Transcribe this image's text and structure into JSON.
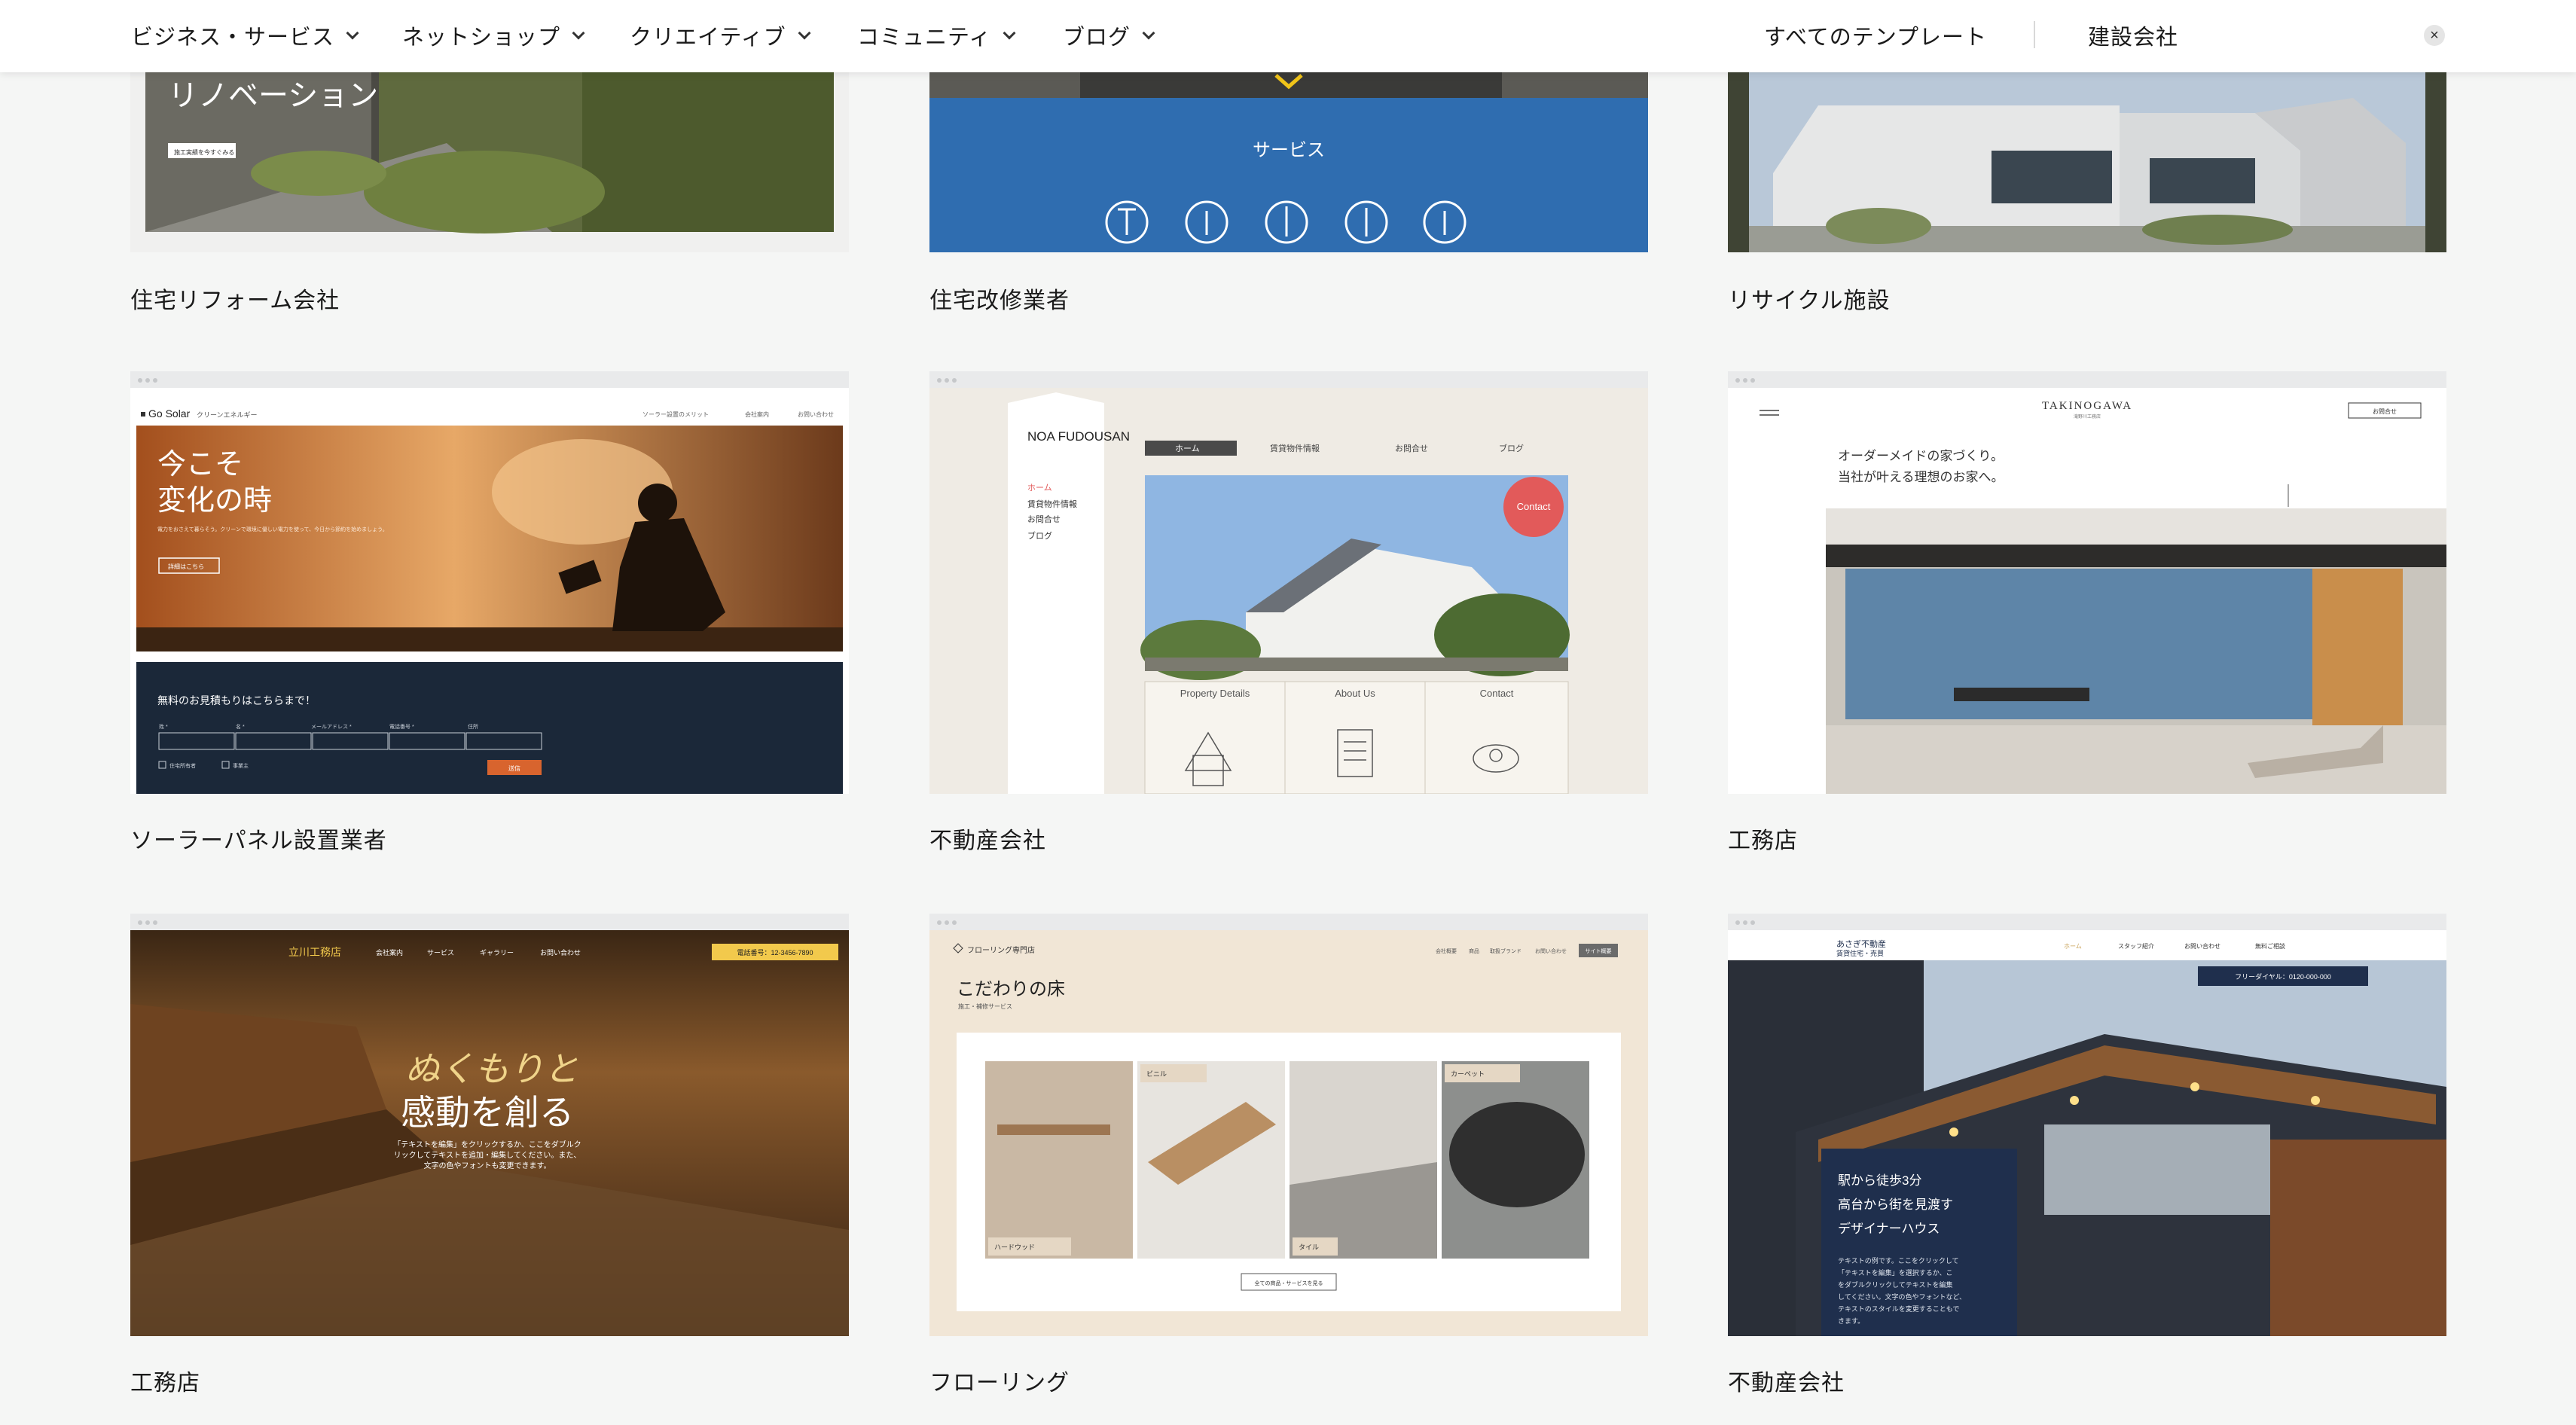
{
  "nav": {
    "items": [
      {
        "label": "ビジネス・サービス"
      },
      {
        "label": "ネットショップ"
      },
      {
        "label": "クリエイティブ"
      },
      {
        "label": "コミュニティ"
      },
      {
        "label": "ブログ"
      }
    ],
    "all_templates": "すべてのテンプレート",
    "search_value": "建設会社",
    "clear_symbol": "×"
  },
  "cards": [
    {
      "caption": "住宅リフォーム会社",
      "preview": {
        "heading": "リノベーション",
        "button": "施工実績を今すぐみる"
      }
    },
    {
      "caption": "住宅改修業者",
      "preview": {
        "heading": "サービス"
      }
    },
    {
      "caption": "リサイクル施設",
      "preview": {}
    },
    {
      "caption": "ソーラーパネル設置業者",
      "preview": {
        "brand": "Go Solar",
        "brand_sub": "クリーンエネルギー",
        "menu": [
          "ソーラー設置のメリット",
          "会社案内",
          "お問い合わせ"
        ],
        "headline1": "今こそ",
        "headline2": "変化の時",
        "body": "電力をおさえて暮らそう。クリーンで環境に優しい電力を使って、今日から節約を始めましょう。",
        "cta": "詳細はこちら",
        "form_title": "無料のお見積もりはこちらまで！",
        "fields": [
          "姓 *",
          "名 *",
          "メールアドレス *",
          "電話番号 *",
          "住所"
        ],
        "checks": [
          "住宅所有者",
          "事業主"
        ],
        "submit": "送信"
      }
    },
    {
      "caption": "不動産会社",
      "preview": {
        "logo": "NOA FUDOUSAN",
        "side_menu": [
          "ホーム",
          "賃貸物件情報",
          "お問合せ",
          "ブログ"
        ],
        "top_menu": [
          "ホーム",
          "賃貸物件情報",
          "お問合せ",
          "ブログ"
        ],
        "badge": "Contact",
        "panels": [
          "Property Details",
          "About Us",
          "Contact"
        ]
      }
    },
    {
      "caption": "工務店",
      "preview": {
        "brand": "TAKINOGAWA",
        "brand_sub": "滝野川工務店",
        "button": "お問合せ",
        "line1": "オーダーメイドの家づくり。",
        "line2": "当社が叶える理想のお家へ。"
      }
    },
    {
      "caption": "工務店",
      "preview": {
        "brand": "立川工務店",
        "menu": [
          "会社案内",
          "サービス",
          "ギャラリー",
          "お問い合わせ"
        ],
        "phone": "電話番号：12-3456-7890",
        "line1": "ぬくもりと",
        "line2": "感動を創る",
        "body1": "「テキストを編集」をクリックするか、ここをダブルク",
        "body2": "リックしてテキストを追加・編集してください。また、",
        "body3": "文字の色やフォントも変更できます。"
      }
    },
    {
      "caption": "フローリング",
      "preview": {
        "brand": "フローリング専門店",
        "menu": [
          "会社概要",
          "商品",
          "取扱ブランド",
          "お問い合わせ"
        ],
        "menu_active": "サイト概要",
        "title": "こだわりの床",
        "subtitle": "施工・補修サービス",
        "tiles": [
          "ハードウッド",
          "ビニル",
          "タイル",
          "カーペット"
        ],
        "button": "全ての商品・サービスを見る"
      }
    },
    {
      "caption": "不動産会社",
      "preview": {
        "brand": "あさぎ不動産",
        "brand_sub": "賃貸住宅・売買",
        "menu": [
          "ホーム",
          "スタッフ紹介",
          "お問い合わせ",
          "無料ご相談"
        ],
        "phone": "フリーダイヤル：0120-000-000",
        "line1": "駅から徒歩3分",
        "line2": "高台から街を見渡す",
        "line3": "デザイナーハウス",
        "body1": "テキストの例です。ここをクリックして",
        "body2": "「テキストを編集」を選択するか、こ",
        "body3": "をダブルクリックしてテキストを編集",
        "body4": "してください。文字の色やフォントなど、",
        "body5": "テキストのスタイルを変更することもで",
        "body6": "きます。"
      }
    }
  ],
  "colors": {
    "page_bg": "#f5f6f5",
    "service_blue": "#2f6db0",
    "solar_navy": "#1b2839",
    "solar_orange": "#d8642e",
    "noa_active": "#4a4a4a",
    "contact_red": "#e25a5a",
    "realestate_navy": "#1f2f4d"
  }
}
